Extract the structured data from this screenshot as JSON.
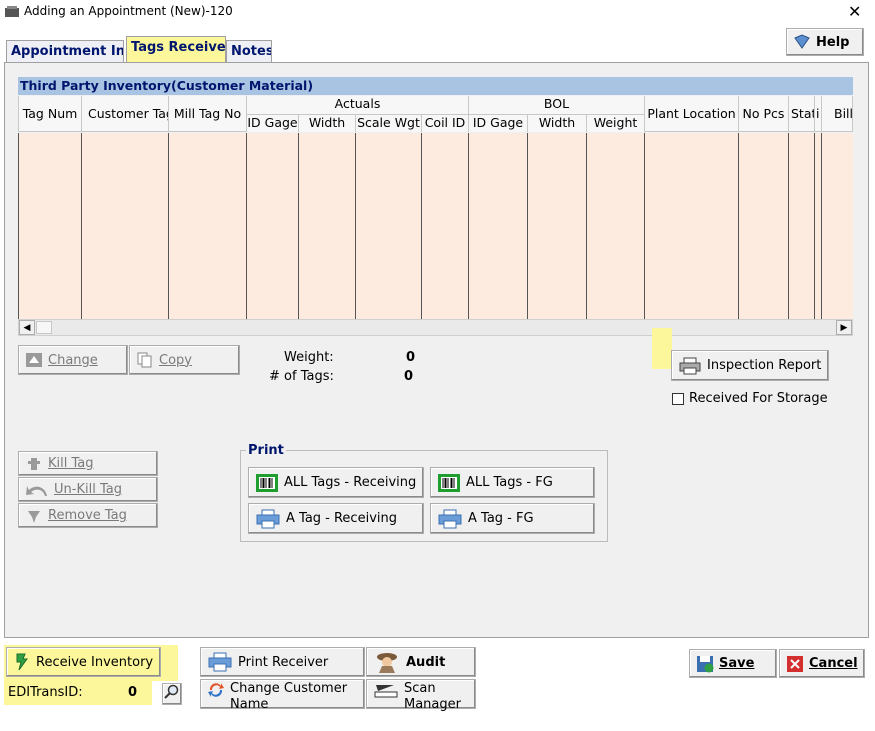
{
  "window": {
    "title": "Adding an Appointment  (New)-120",
    "close_glyph": "✕"
  },
  "tabs": [
    {
      "label": "Appointment Info"
    },
    {
      "label": "Tags Received"
    },
    {
      "label": "Notes"
    }
  ],
  "help_label": "Help",
  "grid": {
    "title": "Third Party Inventory(Customer Material)",
    "columns": {
      "tag_num": "Tag Num",
      "customer_tag": "Customer Tag",
      "mill_tag_no": "Mill Tag No",
      "actuals_group": "Actuals",
      "act_id_gage": "ID Gage",
      "act_width": "Width",
      "act_scale_wgt": "Scale Wgt",
      "act_coil_id": "Coil ID",
      "bol_group": "BOL",
      "bol_id_gage": "ID Gage",
      "bol_width": "Width",
      "bol_weight": "Weight",
      "plant_location": "Plant Location",
      "no_pcs": "No Pcs",
      "status": "Stat",
      "i": "i",
      "bill": "Bill"
    },
    "rows": []
  },
  "edit_buttons": {
    "change": "Change",
    "copy": "Copy"
  },
  "summary": {
    "weight_label": "Weight:",
    "weight_value": "0",
    "tags_label": "# of Tags:",
    "tags_value": "0"
  },
  "inspection_report_label": "Inspection Report",
  "received_for_storage_label": "Received For Storage",
  "received_for_storage_checked": false,
  "tag_buttons": {
    "kill_tag": "Kill Tag",
    "unkill_tag": "Un-Kill Tag",
    "remove_tag": "Remove Tag"
  },
  "print": {
    "legend": "Print",
    "all_receiving": "ALL Tags - Receiving",
    "all_fg": "ALL Tags - FG",
    "a_receiving": "A Tag - Receiving",
    "a_fg": "A Tag - FG"
  },
  "footer": {
    "receive_inventory": "Receive Inventory",
    "edi_label": "EDITransID:",
    "edi_value": "0",
    "print_receiver": "Print Receiver",
    "audit": "Audit",
    "change_customer_name": "Change Customer Name",
    "scan_manager": "Scan Manager",
    "save": "Save",
    "cancel": "Cancel"
  },
  "colors": {
    "highlight": "#fbf79a",
    "grid_body": "#fdebe0",
    "grid_title_bg": "#a9c4e2",
    "title_text": "#00166e"
  }
}
